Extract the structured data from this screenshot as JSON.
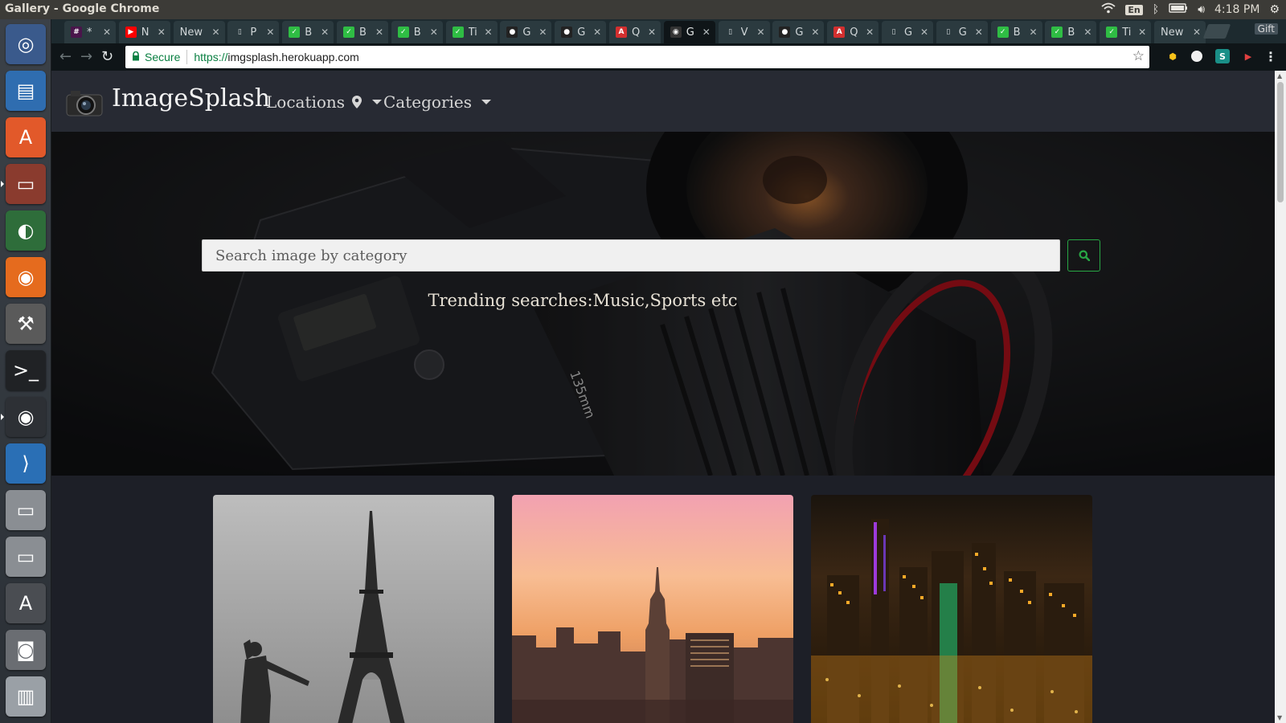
{
  "os": {
    "window_title": "Gallery - Google Chrome",
    "tray": {
      "lang": "En",
      "clock": "4:18 PM"
    }
  },
  "launcher": {
    "items": [
      {
        "name": "ubuntu-dash-icon"
      },
      {
        "name": "libreoffice-writer-icon"
      },
      {
        "name": "ubuntu-software-icon"
      },
      {
        "name": "files-icon"
      },
      {
        "name": "disk-usage-icon"
      },
      {
        "name": "firefox-icon"
      },
      {
        "name": "system-settings-icon"
      },
      {
        "name": "terminal-icon"
      },
      {
        "name": "chrome-icon"
      },
      {
        "name": "vscode-icon"
      },
      {
        "name": "drive-icon"
      },
      {
        "name": "drive-icon"
      },
      {
        "name": "software-updater-icon"
      },
      {
        "name": "camera-icon"
      },
      {
        "name": "trash-icon"
      }
    ]
  },
  "tabs": [
    {
      "label": "*",
      "fav": "#",
      "fav_color": "#4a154b"
    },
    {
      "label": "N",
      "fav": "▶",
      "fav_color": "#ff0000"
    },
    {
      "label": "New",
      "fav": "",
      "fav_color": "transparent"
    },
    {
      "label": "P",
      "fav": "▯",
      "fav_color": "transparent"
    },
    {
      "label": "B",
      "fav": "✓",
      "fav_color": "#2fbd44"
    },
    {
      "label": "B",
      "fav": "✓",
      "fav_color": "#2fbd44"
    },
    {
      "label": "B",
      "fav": "✓",
      "fav_color": "#2fbd44"
    },
    {
      "label": "Ti",
      "fav": "✓",
      "fav_color": "#2fbd44"
    },
    {
      "label": "G",
      "fav": "●",
      "fav_color": "#222"
    },
    {
      "label": "G",
      "fav": "●",
      "fav_color": "#222"
    },
    {
      "label": "Q",
      "fav": "A",
      "fav_color": "#d32f2f"
    },
    {
      "label": "G",
      "fav": "◉",
      "fav_color": "#333",
      "active": true
    },
    {
      "label": "V",
      "fav": "▯",
      "fav_color": "transparent"
    },
    {
      "label": "G",
      "fav": "●",
      "fav_color": "#222"
    },
    {
      "label": "Q",
      "fav": "A",
      "fav_color": "#d32f2f"
    },
    {
      "label": "G",
      "fav": "▯",
      "fav_color": "transparent"
    },
    {
      "label": "G",
      "fav": "▯",
      "fav_color": "transparent"
    },
    {
      "label": "B",
      "fav": "✓",
      "fav_color": "#2fbd44"
    },
    {
      "label": "B",
      "fav": "✓",
      "fav_color": "#2fbd44"
    },
    {
      "label": "Ti",
      "fav": "✓",
      "fav_color": "#2fbd44"
    },
    {
      "label": "New",
      "fav": "",
      "fav_color": "transparent"
    }
  ],
  "chrome": {
    "gift_label": "Gift",
    "secure_label": "Secure",
    "url_protocol": "https://",
    "url_host": "imgsplash.herokuapp.com"
  },
  "site": {
    "brand": "ImageSplash",
    "nav": {
      "locations": "Locations",
      "categories": "Categories"
    },
    "search": {
      "placeholder": "Search image by category"
    },
    "trending": "Trending searches:Music,Sports etc",
    "colors": {
      "navbar_bg": "#272a33",
      "page_bg": "#1d1f27",
      "search_button_border": "#28a745"
    }
  }
}
